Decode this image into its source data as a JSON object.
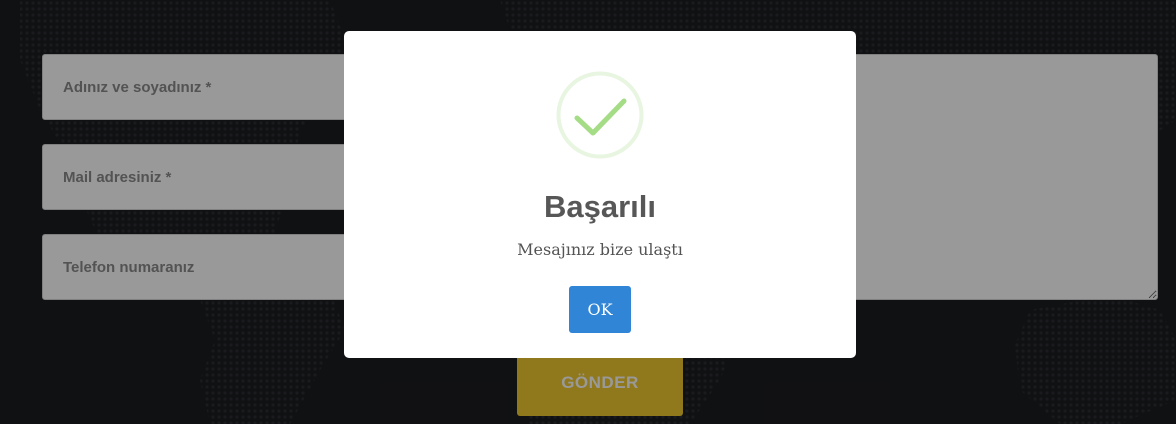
{
  "form": {
    "name_placeholder": "Adınız ve soyadınız *",
    "mail_placeholder": "Mail adresiniz *",
    "phone_placeholder": "Telefon numaranız",
    "message_placeholder": "",
    "submit_label": "GÖNDER"
  },
  "modal": {
    "icon": "success-check-icon",
    "title": "Başarılı",
    "text": "Mesajınız bize ulaştı",
    "ok_label": "OK"
  },
  "colors": {
    "background": "#1c1d21",
    "map_dots": "#2c2d32",
    "submit_button": "#f0c830",
    "overlay": "rgba(0,0,0,0.4)",
    "ok_button": "#3085d6",
    "success_check": "#a5dc86",
    "success_ring": "#e8f5e0",
    "title_text": "#575757",
    "body_text": "#545454"
  }
}
